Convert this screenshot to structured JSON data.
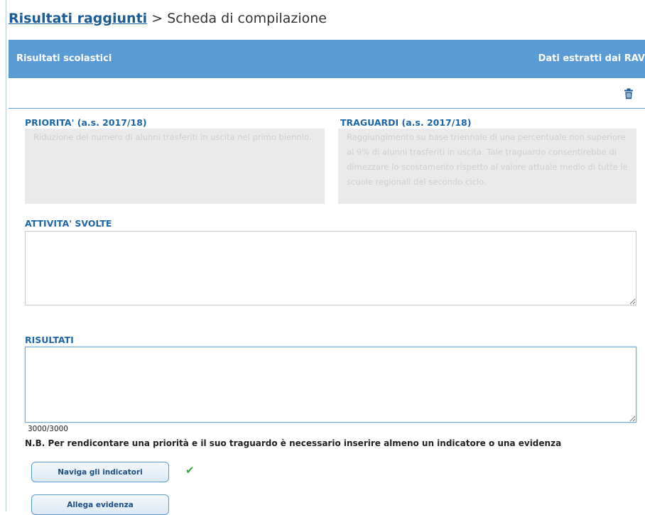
{
  "breadcrumb": {
    "link": "Risultati raggiunti",
    "separator": ">",
    "current": "Scheda di compilazione"
  },
  "header": {
    "title": "Risultati scolastici",
    "source": "Dati estratti dai RAV",
    "color": "#5b9bd5"
  },
  "icons": {
    "delete": "trash-icon",
    "status": "check-icon"
  },
  "priorita": {
    "label": "PRIORITA' (a.s. 2017/18)",
    "value": "Riduzione del numero di alunni trasferiti in uscita nel primo biennio."
  },
  "traguardi": {
    "label": "TRAGUARDI (a.s. 2017/18)",
    "value": "Raggiungimento su base triennale di una percentuale non superiore al 9% di alunni trasferiti in uscita. Tale traguardo consentirebbe di dimezzare lo scostamento rispetto al valore attuale medio di tutte le scuole regionali del secondo ciclo."
  },
  "attivita": {
    "label": "ATTIVITA' SVOLTE",
    "value": ""
  },
  "risultati": {
    "label": "RISULTATI",
    "value": "",
    "counter": "3000/3000"
  },
  "note": "N.B. Per rendicontare una priorità e il suo traguardo è necessario inserire almeno un indicatore o una evidenza",
  "buttons": {
    "indicatori": "Naviga gli indicatori",
    "evidenza": "Allega evidenza"
  },
  "colors": {
    "label": "#1f66a6",
    "check": "#3f9a3f"
  }
}
